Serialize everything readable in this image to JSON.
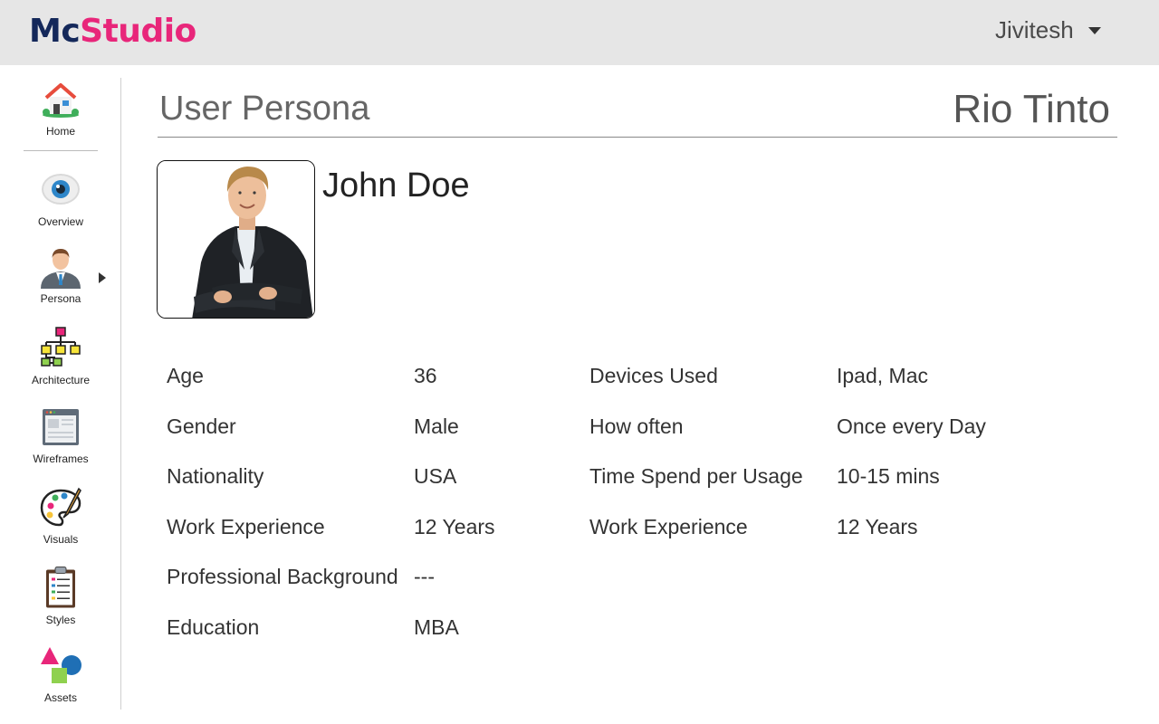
{
  "header": {
    "logo_part1": "Mc",
    "logo_part2": "Studio",
    "user_name": "Jivitesh"
  },
  "sidebar": {
    "items": [
      {
        "label": "Home",
        "icon": "home-icon"
      },
      {
        "label": "Overview",
        "icon": "eye-icon"
      },
      {
        "label": "Persona",
        "icon": "person-icon"
      },
      {
        "label": "Architecture",
        "icon": "sitemap-icon"
      },
      {
        "label": "Wireframes",
        "icon": "wireframe-icon"
      },
      {
        "label": "Visuals",
        "icon": "palette-icon"
      },
      {
        "label": "Styles",
        "icon": "clipboard-icon"
      },
      {
        "label": "Assets",
        "icon": "shapes-icon"
      }
    ]
  },
  "main": {
    "title": "User Persona",
    "client": "Rio Tinto",
    "persona_name": "John Doe",
    "left_details": [
      {
        "label": "Age",
        "value": "36"
      },
      {
        "label": "Gender",
        "value": "Male"
      },
      {
        "label": "Nationality",
        "value": "USA"
      },
      {
        "label": "Work Experience",
        "value": "12 Years"
      },
      {
        "label": "Professional Background",
        "value": "---"
      },
      {
        "label": "Education",
        "value": "MBA"
      }
    ],
    "right_details": [
      {
        "label": "Devices Used",
        "value": "Ipad, Mac"
      },
      {
        "label": "How often",
        "value": "Once every Day"
      },
      {
        "label": "Time Spend per Usage",
        "value": "10-15 mins"
      },
      {
        "label": "Work Experience",
        "value": "12 Years"
      }
    ]
  },
  "colors": {
    "brand_dark": "#14285a",
    "brand_pink": "#e8267a",
    "topbar_bg": "#e6e6e6"
  }
}
